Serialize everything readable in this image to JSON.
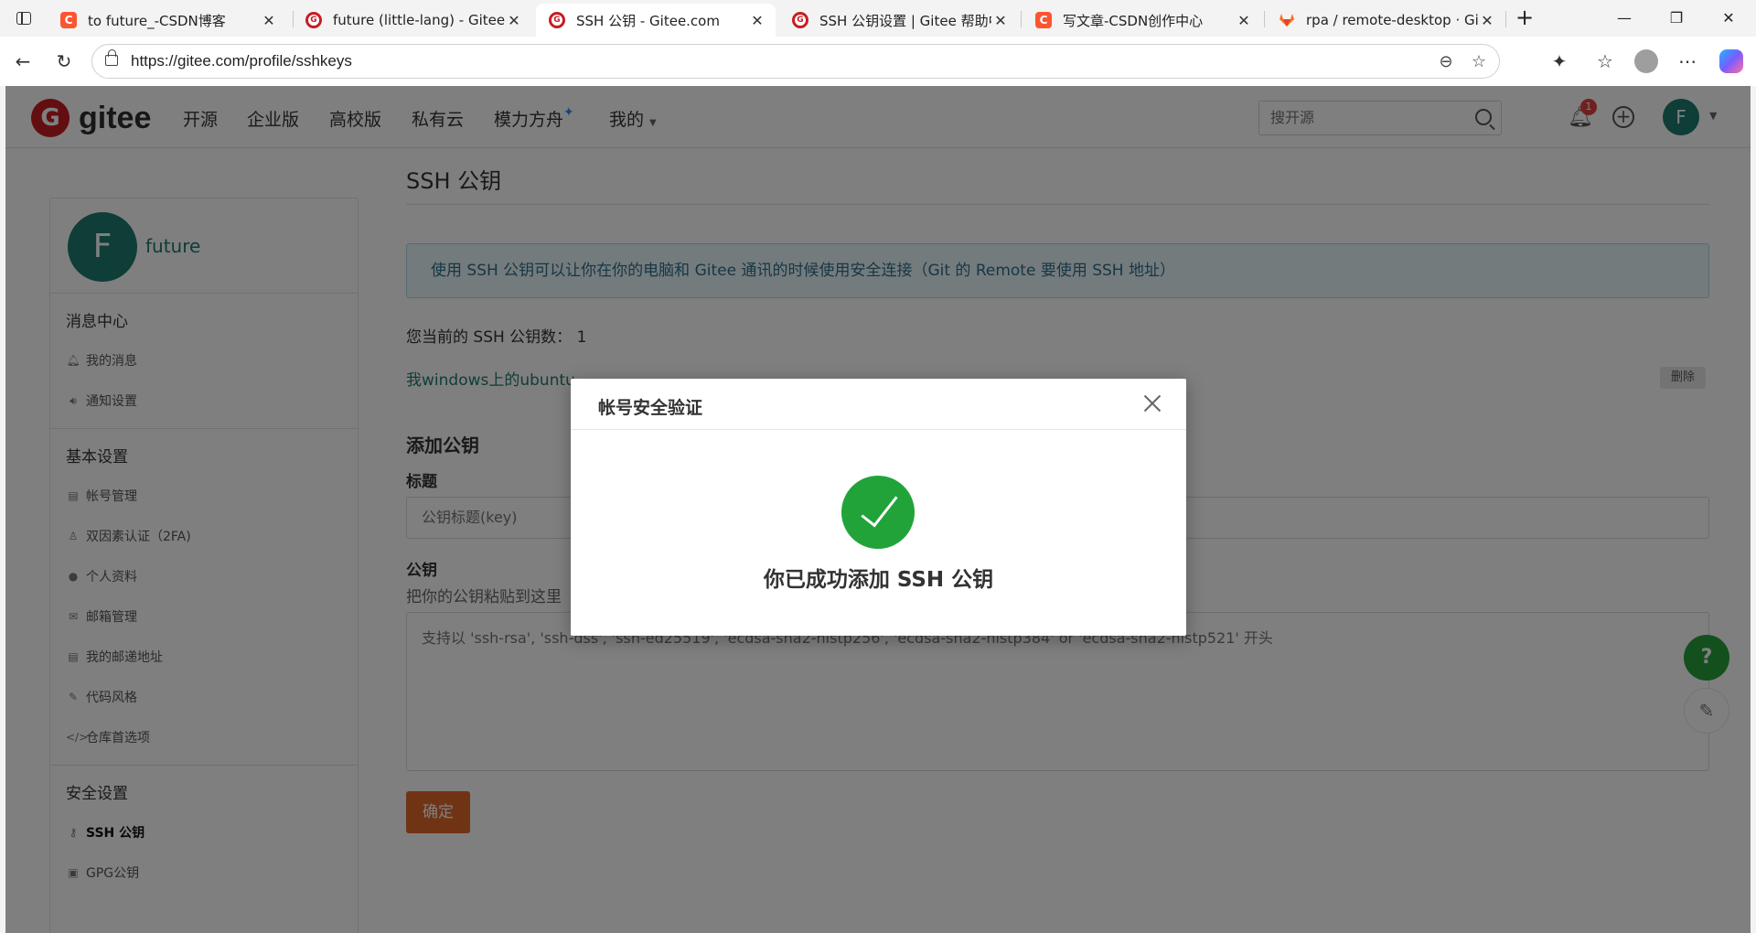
{
  "browser": {
    "tabs": [
      {
        "title": "to future_-CSDN博客",
        "icon": "csdn-icon"
      },
      {
        "title": "future (little-lang) - Gitee.com",
        "icon": "gitee-icon"
      },
      {
        "title": "SSH 公钥 - Gitee.com",
        "icon": "gitee-icon",
        "active": true
      },
      {
        "title": "SSH 公钥设置 | Gitee 帮助中心",
        "icon": "gitee-icon"
      },
      {
        "title": "写文章-CSDN创作中心",
        "icon": "csdn-icon"
      },
      {
        "title": "rpa / remote-desktop · GitLab",
        "icon": "gitlab-icon"
      }
    ],
    "url": "https://gitee.com/profile/sshkeys"
  },
  "nav": {
    "logo": "gitee",
    "items": [
      "开源",
      "企业版",
      "高校版",
      "私有云",
      "模力方舟",
      "我的"
    ],
    "search_placeholder": "搜开源",
    "notification_count": "1",
    "avatar_letter": "F"
  },
  "sidebar": {
    "avatar_letter": "F",
    "username": "future",
    "sections": [
      {
        "title": "消息中心",
        "items": [
          "我的消息",
          "通知设置"
        ]
      },
      {
        "title": "基本设置",
        "items": [
          "帐号管理",
          "双因素认证（2FA)",
          "个人资料",
          "邮箱管理",
          "我的邮递地址",
          "代码风格",
          "仓库首选项"
        ]
      },
      {
        "title": "安全设置",
        "items": [
          "SSH 公钥",
          "GPG公钥"
        ]
      }
    ]
  },
  "main": {
    "title": "SSH 公钥",
    "info": "使用 SSH 公钥可以让你在你的电脑和 Gitee 通讯的时候使用安全连接（Git 的 Remote 要使用 SSH 地址）",
    "count_label": "您当前的 SSH 公钥数：",
    "count_value": "1",
    "key_name": "我windows上的ubuntu",
    "delete_label": "删除",
    "add_title": "添加公钥",
    "title_label": "标题",
    "title_placeholder": "公钥标题(key)",
    "key_label": "公钥",
    "key_hint": "把你的公钥粘贴到这里",
    "key_placeholder": "支持以 'ssh-rsa', 'ssh-dss', 'ssh-ed25519', 'ecdsa-sha2-nistp256', 'ecdsa-sha2-nistp384' or 'ecdsa-sha2-nistp521' 开头",
    "submit_label": "确定"
  },
  "float": {
    "help": "?"
  },
  "modal": {
    "title": "帐号安全验证",
    "message": "你已成功添加 SSH 公钥"
  }
}
